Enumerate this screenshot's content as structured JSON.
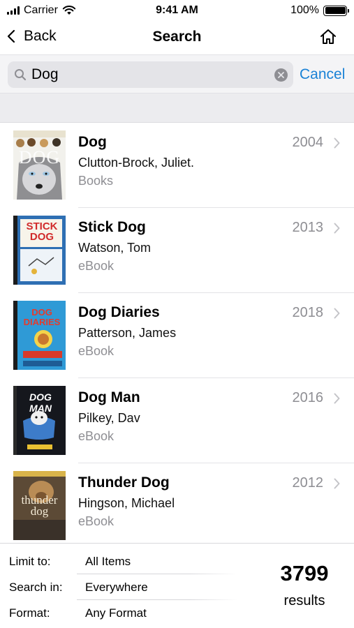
{
  "status_bar": {
    "carrier": "Carrier",
    "time": "9:41 AM",
    "battery_percent": "100%",
    "battery_level": 1.0
  },
  "nav": {
    "back_label": "Back",
    "title": "Search",
    "home_icon": "home-icon"
  },
  "search": {
    "value": "Dog",
    "cancel_label": "Cancel",
    "accent_color": "#1a82d6"
  },
  "results": [
    {
      "title": "Dog",
      "author": "Clutton-Brock, Juliet.",
      "format": "Books",
      "year": "2004",
      "cover_text": "DOG"
    },
    {
      "title": "Stick Dog",
      "author": "Watson, Tom",
      "format": "eBook",
      "year": "2013",
      "cover_text": "STICK DOG"
    },
    {
      "title": "Dog Diaries",
      "author": "Patterson, James",
      "format": "eBook",
      "year": "2018",
      "cover_text": "DOG DIARIES"
    },
    {
      "title": "Dog Man",
      "author": "Pilkey, Dav",
      "format": "eBook",
      "year": "2016",
      "cover_text": "DOG MAN"
    },
    {
      "title": "Thunder Dog",
      "author": "Hingson, Michael",
      "format": "eBook",
      "year": "2012",
      "cover_text": "thunder dog"
    }
  ],
  "footer": {
    "filters": [
      {
        "label": "Limit to:",
        "value": "All Items"
      },
      {
        "label": "Search in:",
        "value": "Everywhere"
      },
      {
        "label": "Format:",
        "value": "Any Format"
      }
    ],
    "count": "3799",
    "count_label": "results"
  }
}
